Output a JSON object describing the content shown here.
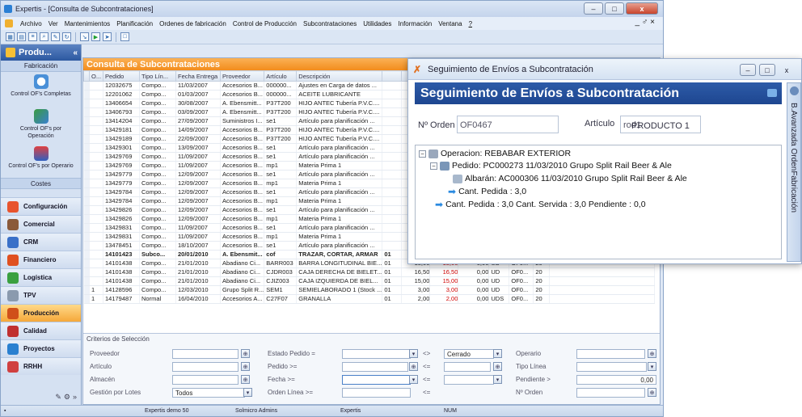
{
  "app": {
    "title": "Expertis - [Consulta de Subcontrataciones]",
    "min": "–",
    "max": "□",
    "close": "x"
  },
  "menu": [
    "Archivo",
    "Ver",
    "Mantenimientos",
    "Planificación",
    "Ordenes de fabricación",
    "Control de Producción",
    "Subcontrataciones",
    "Utilidades",
    "Información",
    "Ventana",
    "?"
  ],
  "mdi_controls": "_ ♂ ×",
  "sidebar": {
    "header": "Produ...",
    "section_fabricacion": "Fabricación",
    "items": [
      "Control OF's Completas",
      "Control OF's por Operación",
      "Control OF's por Operario"
    ],
    "section_costes": "Costes",
    "modules": [
      "Configuración",
      "Comercial",
      "CRM",
      "Financiero",
      "Logística",
      "TPV",
      "Producción",
      "Calidad",
      "Proyectos",
      "RRHH"
    ]
  },
  "content": {
    "title": "Consulta de Subcontrataciones",
    "columns": [
      "O...",
      "Pedido",
      "Tipo Lín...",
      "Fecha Entrega",
      "Proveedor",
      "Artículo",
      "Descripción",
      "",
      "",
      "",
      "",
      "",
      "",
      "",
      ""
    ],
    "rows": [
      [
        "",
        "12032675",
        "Compo...",
        "11/03/2007",
        "Accesorios B...",
        "000000...",
        "Ajustes en Carga de datos ...",
        "",
        "",
        "",
        "",
        "",
        "",
        "",
        ""
      ],
      [
        "",
        "12201062",
        "Compo...",
        "01/03/2007",
        "Accesorios B...",
        "000000...",
        "ACEITE LUBRICANTE",
        "",
        "",
        "",
        "",
        "",
        "",
        "",
        ""
      ],
      [
        "",
        "13406654",
        "Compo...",
        "30/08/2007",
        "A. Ebensmitt...",
        "P37T200",
        "HIJO ANTEC Tubería P.V.C....",
        "",
        "",
        "",
        "",
        "",
        "",
        "",
        ""
      ],
      [
        "",
        "13406793",
        "Compo...",
        "03/09/2007",
        "A. Ebensmitt...",
        "P37T200",
        "HIJO ANTEC Tubería P.V.C....",
        "",
        "",
        "",
        "",
        "",
        "",
        "",
        ""
      ],
      [
        "",
        "13414204",
        "Compo...",
        "27/09/2007",
        "Suministros I...",
        "se1",
        "Artículo para planificación ...",
        "",
        "",
        "",
        "",
        "",
        "",
        "",
        ""
      ],
      [
        "",
        "13429181",
        "Compo...",
        "14/09/2007",
        "Accesorios B...",
        "P37T200",
        "HIJO ANTEC Tubería P.V.C....",
        "",
        "",
        "",
        "",
        "",
        "",
        "",
        ""
      ],
      [
        "",
        "13429189",
        "Compo...",
        "22/09/2007",
        "Accesorios B...",
        "P37T200",
        "HIJO ANTEC Tubería P.V.C....",
        "",
        "",
        "",
        "",
        "",
        "",
        "",
        ""
      ],
      [
        "",
        "13429301",
        "Compo...",
        "13/09/2007",
        "Accesorios B...",
        "se1",
        "Artículo para planificación ...",
        "",
        "",
        "",
        "",
        "",
        "",
        "",
        ""
      ],
      [
        "",
        "13429769",
        "Compo...",
        "11/09/2007",
        "Accesorios B...",
        "se1",
        "Artículo para planificación ...",
        "",
        "",
        "",
        "",
        "",
        "",
        "",
        ""
      ],
      [
        "",
        "13429769",
        "Compo...",
        "11/09/2007",
        "Accesorios B...",
        "mp1",
        "Materia Prima 1",
        "",
        "",
        "",
        "",
        "",
        "",
        "",
        ""
      ],
      [
        "",
        "13429779",
        "Compo...",
        "12/09/2007",
        "Accesorios B...",
        "se1",
        "Artículo para planificación ...",
        "",
        "",
        "",
        "",
        "",
        "",
        "",
        ""
      ],
      [
        "",
        "13429779",
        "Compo...",
        "12/09/2007",
        "Accesorios B...",
        "mp1",
        "Materia Prima 1",
        "",
        "",
        "",
        "",
        "",
        "",
        "",
        ""
      ],
      [
        "",
        "13429784",
        "Compo...",
        "12/09/2007",
        "Accesorios B...",
        "se1",
        "Artículo para planificación ...",
        "",
        "",
        "",
        "",
        "",
        "",
        "",
        ""
      ],
      [
        "",
        "13429784",
        "Compo...",
        "12/09/2007",
        "Accesorios B...",
        "mp1",
        "Materia Prima 1",
        "",
        "",
        "",
        "",
        "",
        "",
        "",
        ""
      ],
      [
        "",
        "13429826",
        "Compo...",
        "12/09/2007",
        "Accesorios B...",
        "se1",
        "Artículo para planificación ...",
        "",
        "",
        "",
        "",
        "",
        "",
        "",
        ""
      ],
      [
        "",
        "13429826",
        "Compo...",
        "12/09/2007",
        "Accesorios B...",
        "mp1",
        "Materia Prima 1",
        "",
        "",
        "",
        "",
        "",
        "",
        "",
        ""
      ],
      [
        "",
        "13429831",
        "Compo...",
        "11/09/2007",
        "Accesorios B...",
        "se1",
        "Artículo para planificación ...",
        "",
        "",
        "",
        "",
        "",
        "",
        "",
        ""
      ],
      [
        "",
        "13429831",
        "Compo...",
        "11/09/2007",
        "Accesorios B...",
        "mp1",
        "Materia Prima 1",
        "",
        "",
        "",
        "",
        "",
        "",
        "",
        ""
      ],
      [
        "",
        "13478451",
        "Compo...",
        "18/10/2007",
        "Accesorios B...",
        "se1",
        "Artículo para planificación ...",
        "",
        "",
        "",
        "",
        "",
        "",
        "",
        ""
      ],
      [
        "",
        "14101423",
        "Subco...",
        "20/01/2010",
        "A. Ebensmit...",
        "cof",
        "TRAZAR, CORTAR, ARMAR",
        "01",
        "95,00",
        "95,00",
        "0,00",
        "KG",
        "OF...",
        "10",
        ""
      ],
      [
        "",
        "14101438",
        "Compo...",
        "21/01/2010",
        "Abadiano Ci...",
        "BARR003",
        "BARRA LONGITUDINAL BIE...",
        "01",
        "15,00",
        "15,00",
        "0,00",
        "UD",
        "OF0...",
        "20",
        ""
      ],
      [
        "",
        "14101438",
        "Compo...",
        "21/01/2010",
        "Abadiano Ci...",
        "CJDR003",
        "CAJA DERECHA DE BIELET...",
        "01",
        "16,50",
        "16,50",
        "0,00",
        "UD",
        "OF0...",
        "20",
        ""
      ],
      [
        "",
        "14101438",
        "Compo...",
        "21/01/2010",
        "Abadiano Ci...",
        "CJIZ003",
        "CAJA IZQUIERDA DE BIEL...",
        "01",
        "15,00",
        "15,00",
        "0,00",
        "UD",
        "OF0...",
        "20",
        ""
      ],
      [
        "1",
        "14128596",
        "Compo...",
        "12/03/2010",
        "Grupo Split R...",
        "SEM1",
        "SEMIELABORADO 1 (Stock ...",
        "01",
        "3,00",
        "3,00",
        "0,00",
        "UD",
        "OF0...",
        "20",
        ""
      ],
      [
        "1",
        "14179487",
        "Normal",
        "16/04/2010",
        "Accesorios A...",
        "C27F07",
        "GRANALLA",
        "01",
        "2,00",
        "2,00",
        "0,00",
        "UDS",
        "OF0...",
        "20",
        ""
      ]
    ]
  },
  "criteria": {
    "title": "Criterios de Selección",
    "proveedor": "Proveedor",
    "articulo": "Artículo",
    "almacen": "Almacén",
    "gestion": "Gestión por Lotes",
    "gestion_value": "Todos",
    "estado": "Estado Pedido =",
    "pedido": "Pedido >=",
    "fecha": "Fecha >=",
    "orden": "Orden Línea >=",
    "op1": "<>",
    "op2": "<=",
    "op3": "<=",
    "op4": "<=",
    "estado_value": "Cerrado",
    "operario": "Operario",
    "tipo": "Tipo Línea",
    "pendiente": "Pendiente >",
    "pendiente_value": "0,00",
    "norden": "Nº Orden"
  },
  "status": {
    "s1": "Expertis demo 50",
    "s2": "Solmicro Admins",
    "s3": "Expertis",
    "s4": "NUM"
  },
  "sub": {
    "window_title": "Seguimiento de Envíos a Subcontratación",
    "header": "Seguimiento de Envíos a Subcontratación",
    "orden_label": "Nº Orden",
    "orden_value": "OF0467",
    "articulo_label": "Artículo",
    "articulo_value": "rod1",
    "articulo_desc": "PRODUCTO 1",
    "side_tab": "B.Avanzada OrdenFabricación",
    "tree": {
      "operacion": "Operacion: REBABAR EXTERIOR",
      "pedido": "Pedido: PC000273  11/03/2010   Grupo Split Rail Beer & Ale",
      "albaran": "Albarán: AC000306  11/03/2010   Grupo Split Rail Beer & Ale",
      "cant1": "Cant. Pedida : 3,0",
      "cant2": "Cant. Pedida : 3,0   Cant. Servida : 3,0   Pendiente : 0,0"
    }
  }
}
